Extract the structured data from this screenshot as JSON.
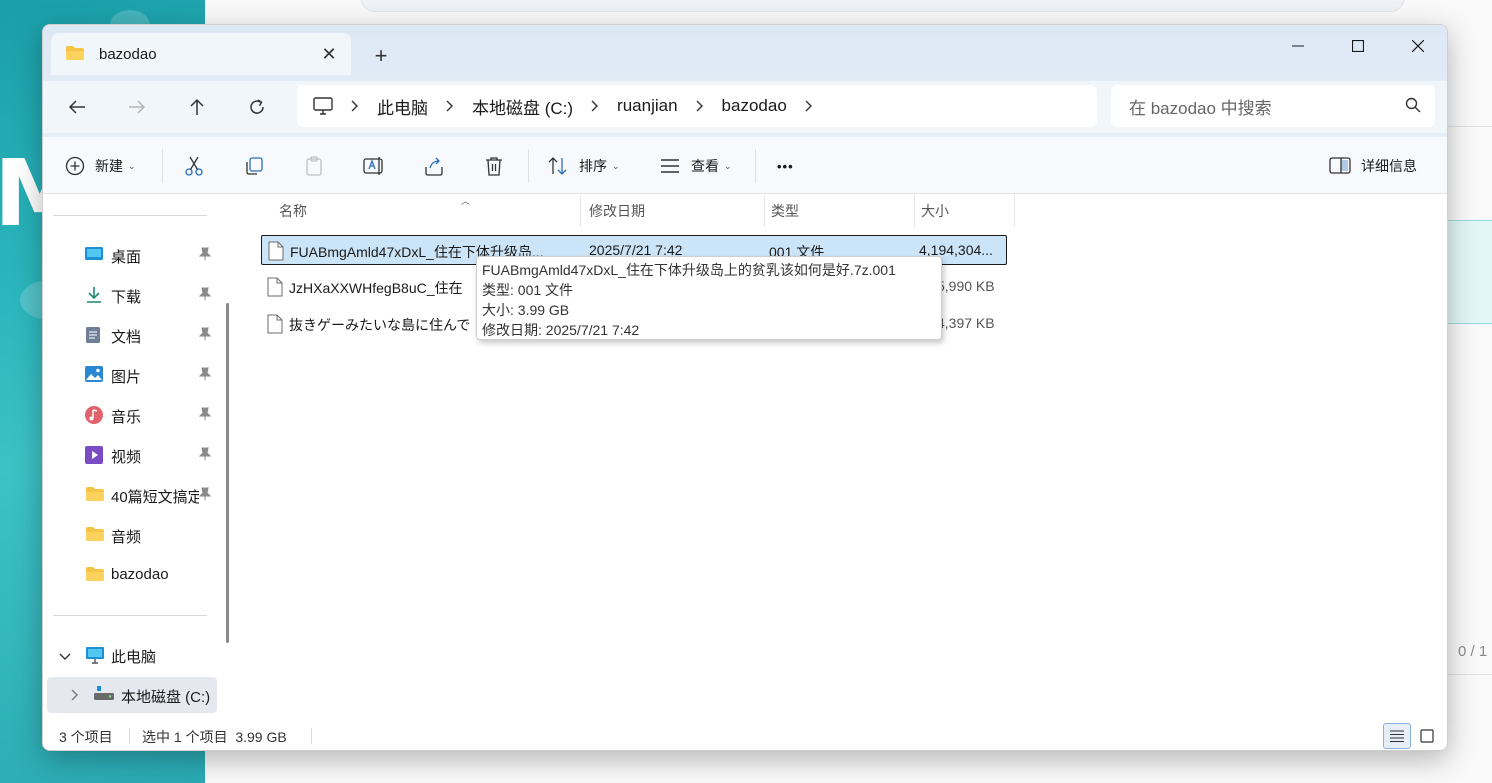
{
  "window": {
    "tab_title": "bazodao",
    "new_tab_label": "+",
    "controls": {
      "minimize": "—",
      "maximize": "☐",
      "close": "✕"
    }
  },
  "address": {
    "crumbs": [
      "此电脑",
      "本地磁盘 (C:)",
      "ruanjian",
      "bazodao"
    ]
  },
  "search": {
    "placeholder": "在 bazodao 中搜索"
  },
  "toolbar": {
    "new_label": "新建",
    "sort_label": "排序",
    "view_label": "查看",
    "more_label": "•••",
    "details_label": "详细信息"
  },
  "sidebar": {
    "items": [
      {
        "label": "桌面",
        "icon": "desktop-icon"
      },
      {
        "label": "下载",
        "icon": "download-icon"
      },
      {
        "label": "文档",
        "icon": "document-icon"
      },
      {
        "label": "图片",
        "icon": "picture-icon"
      },
      {
        "label": "音乐",
        "icon": "music-icon"
      },
      {
        "label": "视频",
        "icon": "video-icon"
      },
      {
        "label": "40篇短文搞定",
        "icon": "folder-icon"
      },
      {
        "label": "音频",
        "icon": "folder-icon"
      },
      {
        "label": "bazodao",
        "icon": "folder-icon"
      }
    ],
    "this_pc": "此电脑",
    "local_disk": "本地磁盘 (C:)"
  },
  "columns": {
    "name": "名称",
    "modified": "修改日期",
    "type": "类型",
    "size": "大小"
  },
  "files": [
    {
      "name": "FUABmgAmld47xDxL_住在下体升级岛...",
      "modified": "2025/7/21 7:42",
      "type": "001 文件",
      "size": "4,194,304..."
    },
    {
      "name": "JzHXaXXWHfegB8uC_住在",
      "modified": "",
      "type": "",
      "size": "5,990 KB"
    },
    {
      "name": "抜きゲーみたいな島に住んで",
      "modified": "",
      "type": "",
      "size": "4,397 KB"
    }
  ],
  "tooltip": {
    "full_name": "FUABmgAmld47xDxL_住在下体升级岛上的贫乳该如何是好.7z.001",
    "type_line": "类型: 001 文件",
    "size_line": "大小: 3.99 GB",
    "date_line": "修改日期: 2025/7/21 7:42"
  },
  "status": {
    "count": "3 个项目",
    "selected": "选中 1 个项目  3.99 GB"
  },
  "background": {
    "page_counter": "0 / 1"
  },
  "colors": {
    "accent": "#0067c0",
    "selection": "#cce4f7",
    "folder": "#f6c445"
  }
}
